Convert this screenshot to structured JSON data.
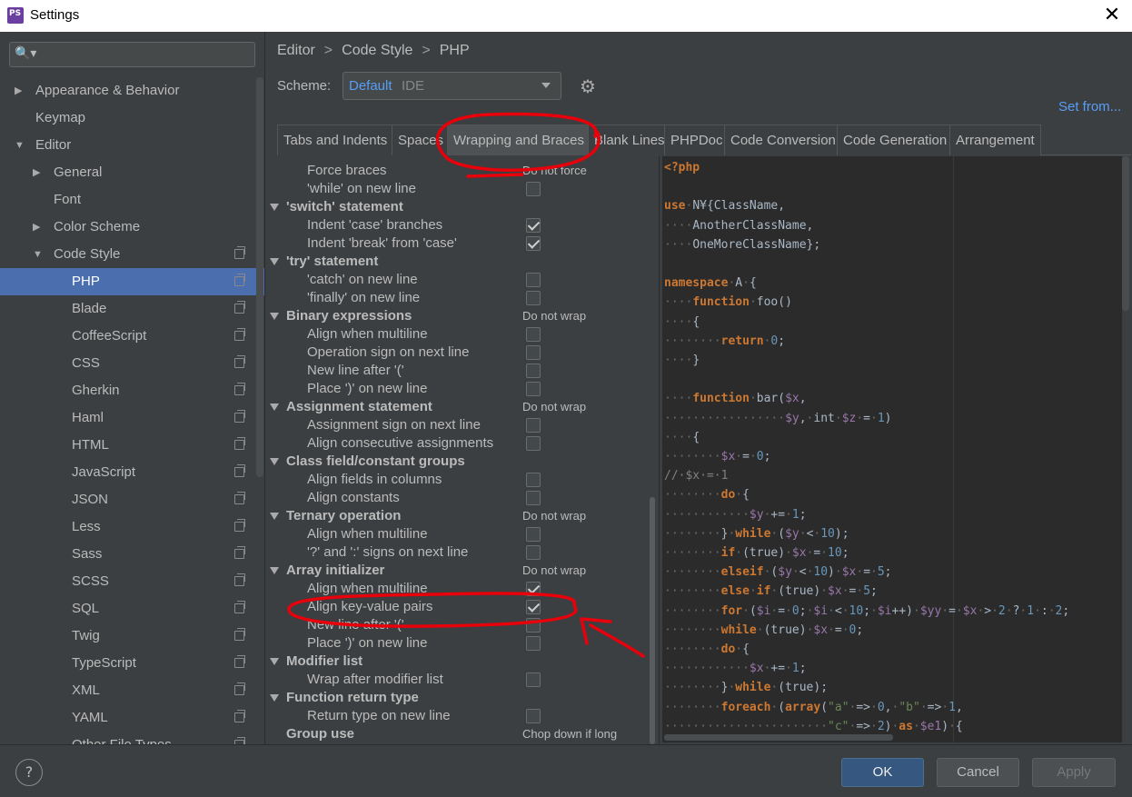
{
  "window": {
    "title": "Settings",
    "close": "✕",
    "app_icon": "phpstorm-icon"
  },
  "search": {
    "icon": "🔍▾",
    "placeholder": ""
  },
  "sidebar": {
    "items": [
      {
        "label": "Appearance & Behavior",
        "level": 0,
        "arrow": "▶"
      },
      {
        "label": "Keymap",
        "level": 0,
        "arrow": ""
      },
      {
        "label": "Editor",
        "level": 0,
        "arrow": "▼"
      },
      {
        "label": "General",
        "level": 1,
        "arrow": "▶"
      },
      {
        "label": "Font",
        "level": 1,
        "arrow": ""
      },
      {
        "label": "Color Scheme",
        "level": 1,
        "arrow": "▶"
      },
      {
        "label": "Code Style",
        "level": 1,
        "arrow": "▼",
        "copy": true
      },
      {
        "label": "PHP",
        "level": 2,
        "selected": true,
        "copy": true
      },
      {
        "label": "Blade",
        "level": 2,
        "copy": true
      },
      {
        "label": "CoffeeScript",
        "level": 2,
        "copy": true
      },
      {
        "label": "CSS",
        "level": 2,
        "copy": true
      },
      {
        "label": "Gherkin",
        "level": 2,
        "copy": true
      },
      {
        "label": "Haml",
        "level": 2,
        "copy": true
      },
      {
        "label": "HTML",
        "level": 2,
        "copy": true
      },
      {
        "label": "JavaScript",
        "level": 2,
        "copy": true
      },
      {
        "label": "JSON",
        "level": 2,
        "copy": true
      },
      {
        "label": "Less",
        "level": 2,
        "copy": true
      },
      {
        "label": "Sass",
        "level": 2,
        "copy": true
      },
      {
        "label": "SCSS",
        "level": 2,
        "copy": true
      },
      {
        "label": "SQL",
        "level": 2,
        "copy": true
      },
      {
        "label": "Twig",
        "level": 2,
        "copy": true
      },
      {
        "label": "TypeScript",
        "level": 2,
        "copy": true
      },
      {
        "label": "XML",
        "level": 2,
        "copy": true
      },
      {
        "label": "YAML",
        "level": 2,
        "copy": true
      },
      {
        "label": "Other File Types",
        "level": 2,
        "copy": true
      }
    ]
  },
  "breadcrumb": {
    "parts": [
      "Editor",
      "Code Style",
      "PHP"
    ],
    "separator": ">"
  },
  "scheme": {
    "label": "Scheme:",
    "value": "Default",
    "type": "IDE"
  },
  "set_from": "Set from...",
  "tabs": [
    {
      "label": "Tabs and Indents"
    },
    {
      "label": "Spaces"
    },
    {
      "label": "Wrapping and Braces",
      "active": true
    },
    {
      "label": "Blank Lines"
    },
    {
      "label": "PHPDoc"
    },
    {
      "label": "Code Conversion"
    },
    {
      "label": "Code Generation"
    },
    {
      "label": "Arrangement"
    }
  ],
  "options": [
    {
      "label": "Force braces",
      "kind": "item",
      "value": "Do not force"
    },
    {
      "label": "'while' on new line",
      "kind": "item",
      "checkbox": false
    },
    {
      "label": "'switch' statement",
      "kind": "group"
    },
    {
      "label": "Indent 'case' branches",
      "kind": "item",
      "checkbox": true
    },
    {
      "label": "Indent 'break' from 'case'",
      "kind": "item",
      "checkbox": true
    },
    {
      "label": "'try' statement",
      "kind": "group"
    },
    {
      "label": "'catch' on new line",
      "kind": "item",
      "checkbox": false
    },
    {
      "label": "'finally' on new line",
      "kind": "item",
      "checkbox": false
    },
    {
      "label": "Binary expressions",
      "kind": "group",
      "value": "Do not wrap"
    },
    {
      "label": "Align when multiline",
      "kind": "item",
      "checkbox": false
    },
    {
      "label": "Operation sign on next line",
      "kind": "item",
      "checkbox": false
    },
    {
      "label": "New line after '('",
      "kind": "item",
      "checkbox": false
    },
    {
      "label": "Place ')' on new line",
      "kind": "item",
      "checkbox": false
    },
    {
      "label": "Assignment statement",
      "kind": "group",
      "value": "Do not wrap"
    },
    {
      "label": "Assignment sign on next line",
      "kind": "item",
      "checkbox": false
    },
    {
      "label": "Align consecutive assignments",
      "kind": "item",
      "checkbox": false
    },
    {
      "label": "Class field/constant groups",
      "kind": "group"
    },
    {
      "label": "Align fields in columns",
      "kind": "item",
      "checkbox": false
    },
    {
      "label": "Align constants",
      "kind": "item",
      "checkbox": false
    },
    {
      "label": "Ternary operation",
      "kind": "group",
      "value": "Do not wrap"
    },
    {
      "label": "Align when multiline",
      "kind": "item",
      "checkbox": false
    },
    {
      "label": "'?' and ':' signs on next line",
      "kind": "item",
      "checkbox": false
    },
    {
      "label": "Array initializer",
      "kind": "group",
      "value": "Do not wrap"
    },
    {
      "label": "Align when multiline",
      "kind": "item",
      "checkbox": true
    },
    {
      "label": "Align key-value pairs",
      "kind": "item",
      "checkbox": true
    },
    {
      "label": "New line after '('",
      "kind": "item",
      "checkbox": false
    },
    {
      "label": "Place ')' on new line",
      "kind": "item",
      "checkbox": false
    },
    {
      "label": "Modifier list",
      "kind": "group"
    },
    {
      "label": "Wrap after modifier list",
      "kind": "item",
      "checkbox": false
    },
    {
      "label": "Function return type",
      "kind": "group"
    },
    {
      "label": "Return type on new line",
      "kind": "item",
      "checkbox": false
    },
    {
      "label": "Group use",
      "kind": "group-noarrow",
      "value": "Chop down if long"
    }
  ],
  "code_lines": [
    [
      [
        "kw",
        "<?php"
      ]
    ],
    [],
    [
      [
        "kw",
        "use"
      ],
      [
        "dt",
        "·"
      ],
      [
        "",
        "N¥{ClassName,"
      ]
    ],
    [
      [
        "dt",
        "····"
      ],
      [
        "",
        "AnotherClassName,"
      ]
    ],
    [
      [
        "dt",
        "····"
      ],
      [
        "",
        "OneMoreClassName};"
      ]
    ],
    [],
    [
      [
        "kw",
        "namespace"
      ],
      [
        "dt",
        "·"
      ],
      [
        "",
        "A"
      ],
      [
        "dt",
        "·"
      ],
      [
        "",
        "{"
      ]
    ],
    [
      [
        "dt",
        "····"
      ],
      [
        "kw",
        "function"
      ],
      [
        "dt",
        "·"
      ],
      [
        "",
        "foo()"
      ]
    ],
    [
      [
        "dt",
        "····"
      ],
      [
        "",
        "{"
      ]
    ],
    [
      [
        "dt",
        "········"
      ],
      [
        "kw",
        "return"
      ],
      [
        "dt",
        "·"
      ],
      [
        "num",
        "0"
      ],
      [
        "",
        ";"
      ]
    ],
    [
      [
        "dt",
        "····"
      ],
      [
        "",
        "}"
      ]
    ],
    [],
    [
      [
        "dt",
        "····"
      ],
      [
        "kw",
        "function"
      ],
      [
        "dt",
        "·"
      ],
      [
        "",
        "bar("
      ],
      [
        "var",
        "$x"
      ],
      [
        "",
        ","
      ]
    ],
    [
      [
        "dt",
        "·················"
      ],
      [
        "var",
        "$y"
      ],
      [
        "",
        ","
      ],
      [
        "dt",
        "·"
      ],
      [
        "",
        "int"
      ],
      [
        "dt",
        "·"
      ],
      [
        "var",
        "$z"
      ],
      [
        "dt",
        "·"
      ],
      [
        "",
        "="
      ],
      [
        "dt",
        "·"
      ],
      [
        "num",
        "1"
      ],
      [
        "",
        ")"
      ]
    ],
    [
      [
        "dt",
        "····"
      ],
      [
        "",
        "{"
      ]
    ],
    [
      [
        "dt",
        "········"
      ],
      [
        "var",
        "$x"
      ],
      [
        "dt",
        "·"
      ],
      [
        "",
        "="
      ],
      [
        "dt",
        "·"
      ],
      [
        "num",
        "0"
      ],
      [
        "",
        ";"
      ]
    ],
    [
      [
        "cm",
        "//·$x·=·1"
      ]
    ],
    [
      [
        "dt",
        "········"
      ],
      [
        "kw",
        "do"
      ],
      [
        "dt",
        "·"
      ],
      [
        "",
        "{"
      ]
    ],
    [
      [
        "dt",
        "············"
      ],
      [
        "var",
        "$y"
      ],
      [
        "dt",
        "·"
      ],
      [
        "",
        "+="
      ],
      [
        "dt",
        "·"
      ],
      [
        "num",
        "1"
      ],
      [
        "",
        ";"
      ]
    ],
    [
      [
        "dt",
        "········"
      ],
      [
        "",
        "}"
      ],
      [
        "dt",
        "·"
      ],
      [
        "kw",
        "while"
      ],
      [
        "dt",
        "·"
      ],
      [
        "",
        "("
      ],
      [
        "var",
        "$y"
      ],
      [
        "dt",
        "·"
      ],
      [
        "",
        "<"
      ],
      [
        "dt",
        "·"
      ],
      [
        "num",
        "10"
      ],
      [
        "",
        ");"
      ]
    ],
    [
      [
        "dt",
        "········"
      ],
      [
        "kw",
        "if"
      ],
      [
        "dt",
        "·"
      ],
      [
        "",
        "(true)"
      ],
      [
        "dt",
        "·"
      ],
      [
        "var",
        "$x"
      ],
      [
        "dt",
        "·"
      ],
      [
        "",
        "="
      ],
      [
        "dt",
        "·"
      ],
      [
        "num",
        "10"
      ],
      [
        "",
        ";"
      ]
    ],
    [
      [
        "dt",
        "········"
      ],
      [
        "kw",
        "elseif"
      ],
      [
        "dt",
        "·"
      ],
      [
        "",
        "("
      ],
      [
        "var",
        "$y"
      ],
      [
        "dt",
        "·"
      ],
      [
        "",
        "<"
      ],
      [
        "dt",
        "·"
      ],
      [
        "num",
        "10"
      ],
      [
        "",
        ")"
      ],
      [
        "dt",
        "·"
      ],
      [
        "var",
        "$x"
      ],
      [
        "dt",
        "·"
      ],
      [
        "",
        "="
      ],
      [
        "dt",
        "·"
      ],
      [
        "num",
        "5"
      ],
      [
        "",
        ";"
      ]
    ],
    [
      [
        "dt",
        "········"
      ],
      [
        "kw",
        "else"
      ],
      [
        "dt",
        "·"
      ],
      [
        "kw",
        "if"
      ],
      [
        "dt",
        "·"
      ],
      [
        "",
        "(true)"
      ],
      [
        "dt",
        "·"
      ],
      [
        "var",
        "$x"
      ],
      [
        "dt",
        "·"
      ],
      [
        "",
        "="
      ],
      [
        "dt",
        "·"
      ],
      [
        "num",
        "5"
      ],
      [
        "",
        ";"
      ]
    ],
    [
      [
        "dt",
        "········"
      ],
      [
        "kw",
        "for"
      ],
      [
        "dt",
        "·"
      ],
      [
        "",
        "("
      ],
      [
        "var",
        "$i"
      ],
      [
        "dt",
        "·"
      ],
      [
        "",
        "="
      ],
      [
        "dt",
        "·"
      ],
      [
        "num",
        "0"
      ],
      [
        "",
        ";"
      ],
      [
        "dt",
        "·"
      ],
      [
        "var",
        "$i"
      ],
      [
        "dt",
        "·"
      ],
      [
        "",
        "<"
      ],
      [
        "dt",
        "·"
      ],
      [
        "num",
        "10"
      ],
      [
        "",
        ";"
      ],
      [
        "dt",
        "·"
      ],
      [
        "var",
        "$i"
      ],
      [
        "",
        "++)"
      ],
      [
        "dt",
        "·"
      ],
      [
        "var",
        "$yy"
      ],
      [
        "dt",
        "·"
      ],
      [
        "",
        "="
      ],
      [
        "dt",
        "·"
      ],
      [
        "var",
        "$x"
      ],
      [
        "dt",
        "·"
      ],
      [
        "",
        ">"
      ],
      [
        "dt",
        "·"
      ],
      [
        "num",
        "2"
      ],
      [
        "dt",
        "·"
      ],
      [
        "",
        "?"
      ],
      [
        "dt",
        "·"
      ],
      [
        "num",
        "1"
      ],
      [
        "dt",
        "·"
      ],
      [
        "",
        ":"
      ],
      [
        "dt",
        "·"
      ],
      [
        "num",
        "2"
      ],
      [
        "",
        ";"
      ]
    ],
    [
      [
        "dt",
        "········"
      ],
      [
        "kw",
        "while"
      ],
      [
        "dt",
        "·"
      ],
      [
        "",
        "(true)"
      ],
      [
        "dt",
        "·"
      ],
      [
        "var",
        "$x"
      ],
      [
        "dt",
        "·"
      ],
      [
        "",
        "="
      ],
      [
        "dt",
        "·"
      ],
      [
        "num",
        "0"
      ],
      [
        "",
        ";"
      ]
    ],
    [
      [
        "dt",
        "········"
      ],
      [
        "kw",
        "do"
      ],
      [
        "dt",
        "·"
      ],
      [
        "",
        "{"
      ]
    ],
    [
      [
        "dt",
        "············"
      ],
      [
        "var",
        "$x"
      ],
      [
        "dt",
        "·"
      ],
      [
        "",
        "+="
      ],
      [
        "dt",
        "·"
      ],
      [
        "num",
        "1"
      ],
      [
        "",
        ";"
      ]
    ],
    [
      [
        "dt",
        "········"
      ],
      [
        "",
        "}"
      ],
      [
        "dt",
        "·"
      ],
      [
        "kw",
        "while"
      ],
      [
        "dt",
        "·"
      ],
      [
        "",
        "(true);"
      ]
    ],
    [
      [
        "dt",
        "········"
      ],
      [
        "kw",
        "foreach"
      ],
      [
        "dt",
        "·"
      ],
      [
        "",
        "("
      ],
      [
        "kw",
        "array"
      ],
      [
        "",
        "("
      ],
      [
        "str",
        "\"a\""
      ],
      [
        "dt",
        "·"
      ],
      [
        "",
        "=>"
      ],
      [
        "dt",
        "·"
      ],
      [
        "num",
        "0"
      ],
      [
        "",
        ","
      ],
      [
        "dt",
        "·"
      ],
      [
        "str",
        "\"b\""
      ],
      [
        "dt",
        "·"
      ],
      [
        "",
        "=>"
      ],
      [
        "dt",
        "·"
      ],
      [
        "num",
        "1"
      ],
      [
        "",
        ","
      ]
    ],
    [
      [
        "dt",
        "·······················"
      ],
      [
        "str",
        "\"c\""
      ],
      [
        "dt",
        "·"
      ],
      [
        "",
        "=>"
      ],
      [
        "dt",
        "·"
      ],
      [
        "num",
        "2"
      ],
      [
        "",
        ")"
      ],
      [
        "dt",
        "·"
      ],
      [
        "kw",
        "as"
      ],
      [
        "dt",
        "·"
      ],
      [
        "var",
        "$e1"
      ],
      [
        "",
        ")"
      ],
      [
        "dt",
        "·"
      ],
      [
        "",
        "{"
      ]
    ]
  ],
  "buttons": {
    "help": "?",
    "ok": "OK",
    "cancel": "Cancel",
    "apply": "Apply"
  },
  "colors": {
    "accent": "#4b6eaf",
    "link": "#589df6",
    "annotation": "#e8000b"
  }
}
